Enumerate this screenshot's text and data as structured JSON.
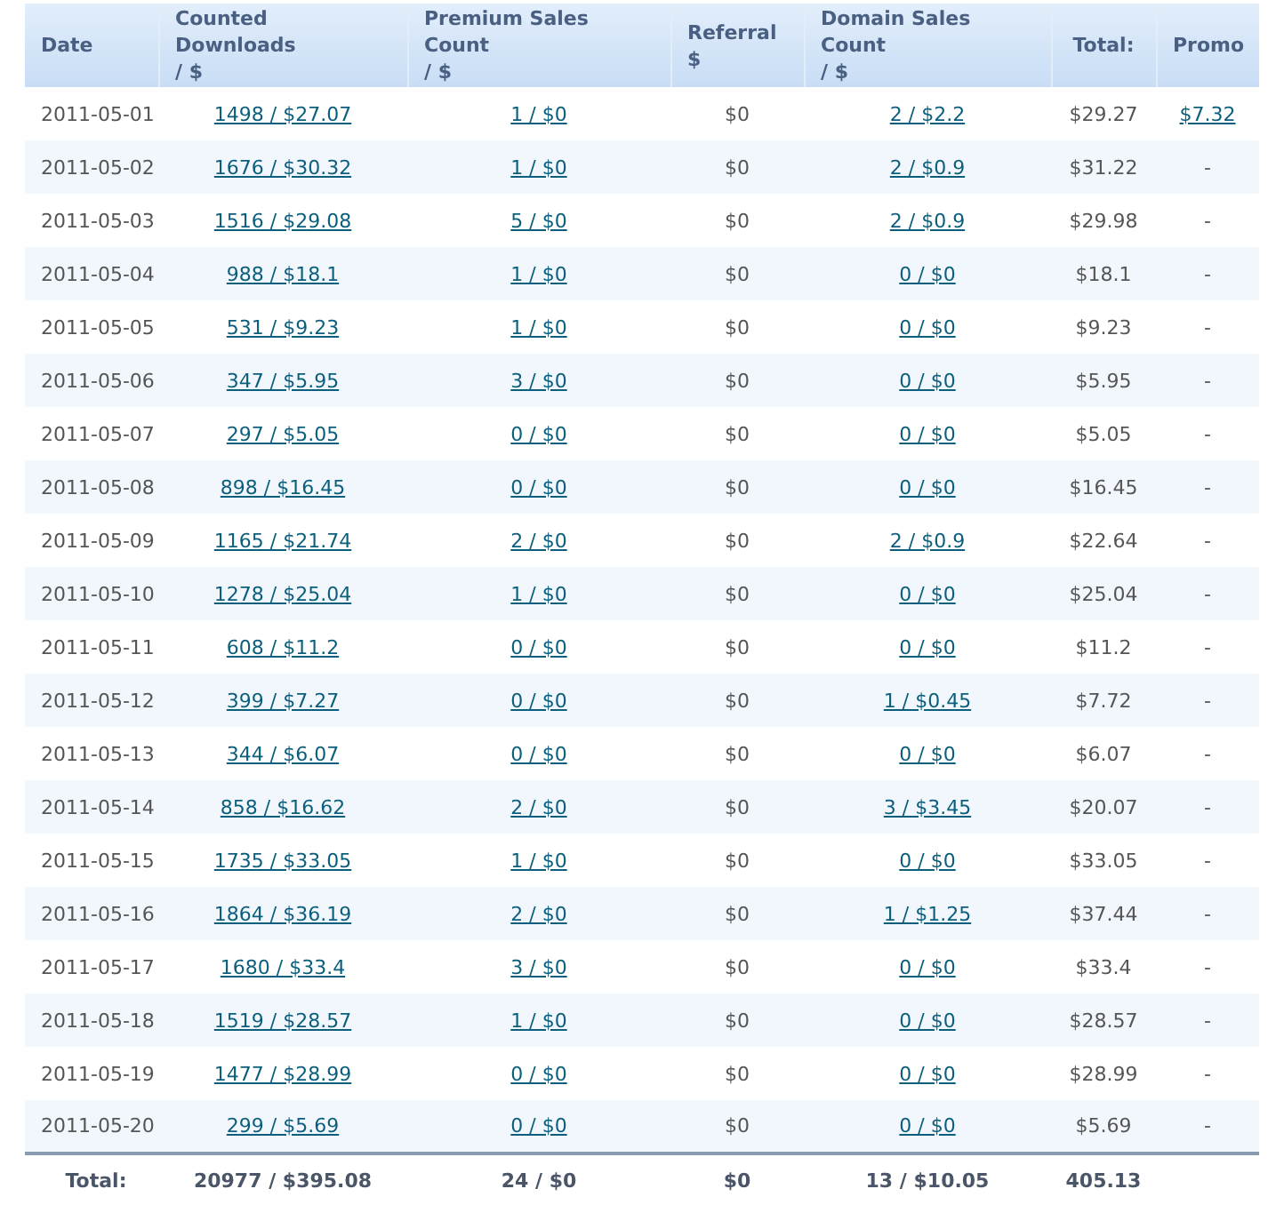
{
  "table": {
    "columns": [
      {
        "lines": [
          "Date"
        ],
        "kind": "text"
      },
      {
        "lines": [
          "Counted Downloads",
          "/ $"
        ],
        "kind": "link"
      },
      {
        "lines": [
          "Premium Sales Count",
          "/ $"
        ],
        "kind": "link"
      },
      {
        "lines": [
          "Referral",
          "$"
        ],
        "kind": "text"
      },
      {
        "lines": [
          "Domain Sales Count",
          "/ $"
        ],
        "kind": "link"
      },
      {
        "lines": [
          "Total:"
        ],
        "kind": "text"
      },
      {
        "lines": [
          "Promo"
        ],
        "kind": "promo"
      }
    ],
    "rows": [
      {
        "cells": [
          "2011-05-01",
          "1498 / $27.07",
          "1 / $0",
          "$0",
          "2 / $2.2",
          "$29.27",
          "$7.32"
        ],
        "promo_linked": true
      },
      {
        "cells": [
          "2011-05-02",
          "1676 / $30.32",
          "1 / $0",
          "$0",
          "2 / $0.9",
          "$31.22",
          "-"
        ],
        "promo_linked": false
      },
      {
        "cells": [
          "2011-05-03",
          "1516 / $29.08",
          "5 / $0",
          "$0",
          "2 / $0.9",
          "$29.98",
          "-"
        ],
        "promo_linked": false
      },
      {
        "cells": [
          "2011-05-04",
          "988 / $18.1",
          "1 / $0",
          "$0",
          "0 / $0",
          "$18.1",
          "-"
        ],
        "promo_linked": false
      },
      {
        "cells": [
          "2011-05-05",
          "531 / $9.23",
          "1 / $0",
          "$0",
          "0 / $0",
          "$9.23",
          "-"
        ],
        "promo_linked": false
      },
      {
        "cells": [
          "2011-05-06",
          "347 / $5.95",
          "3 / $0",
          "$0",
          "0 / $0",
          "$5.95",
          "-"
        ],
        "promo_linked": false
      },
      {
        "cells": [
          "2011-05-07",
          "297 / $5.05",
          "0 / $0",
          "$0",
          "0 / $0",
          "$5.05",
          "-"
        ],
        "promo_linked": false
      },
      {
        "cells": [
          "2011-05-08",
          "898 / $16.45",
          "0 / $0",
          "$0",
          "0 / $0",
          "$16.45",
          "-"
        ],
        "promo_linked": false
      },
      {
        "cells": [
          "2011-05-09",
          "1165 / $21.74",
          "2 / $0",
          "$0",
          "2 / $0.9",
          "$22.64",
          "-"
        ],
        "promo_linked": false
      },
      {
        "cells": [
          "2011-05-10",
          "1278 / $25.04",
          "1 / $0",
          "$0",
          "0 / $0",
          "$25.04",
          "-"
        ],
        "promo_linked": false
      },
      {
        "cells": [
          "2011-05-11",
          "608 / $11.2",
          "0 / $0",
          "$0",
          "0 / $0",
          "$11.2",
          "-"
        ],
        "promo_linked": false
      },
      {
        "cells": [
          "2011-05-12",
          "399 / $7.27",
          "0 / $0",
          "$0",
          "1 / $0.45",
          "$7.72",
          "-"
        ],
        "promo_linked": false
      },
      {
        "cells": [
          "2011-05-13",
          "344 / $6.07",
          "0 / $0",
          "$0",
          "0 / $0",
          "$6.07",
          "-"
        ],
        "promo_linked": false
      },
      {
        "cells": [
          "2011-05-14",
          "858 / $16.62",
          "2 / $0",
          "$0",
          "3 / $3.45",
          "$20.07",
          "-"
        ],
        "promo_linked": false
      },
      {
        "cells": [
          "2011-05-15",
          "1735 / $33.05",
          "1 / $0",
          "$0",
          "0 / $0",
          "$33.05",
          "-"
        ],
        "promo_linked": false
      },
      {
        "cells": [
          "2011-05-16",
          "1864 / $36.19",
          "2 / $0",
          "$0",
          "1 / $1.25",
          "$37.44",
          "-"
        ],
        "promo_linked": false
      },
      {
        "cells": [
          "2011-05-17",
          "1680 / $33.4",
          "3 / $0",
          "$0",
          "0 / $0",
          "$33.4",
          "-"
        ],
        "promo_linked": false
      },
      {
        "cells": [
          "2011-05-18",
          "1519 / $28.57",
          "1 / $0",
          "$0",
          "0 / $0",
          "$28.57",
          "-"
        ],
        "promo_linked": false
      },
      {
        "cells": [
          "2011-05-19",
          "1477 / $28.99",
          "0 / $0",
          "$0",
          "0 / $0",
          "$28.99",
          "-"
        ],
        "promo_linked": false
      },
      {
        "cells": [
          "2011-05-20",
          "299 / $5.69",
          "0 / $0",
          "$0",
          "0 / $0",
          "$5.69",
          "-"
        ],
        "promo_linked": false
      }
    ],
    "totals": [
      "Total:",
      "20977 / $395.08",
      "24 / $0",
      "$0",
      "13 / $10.05",
      "405.13"
    ]
  }
}
